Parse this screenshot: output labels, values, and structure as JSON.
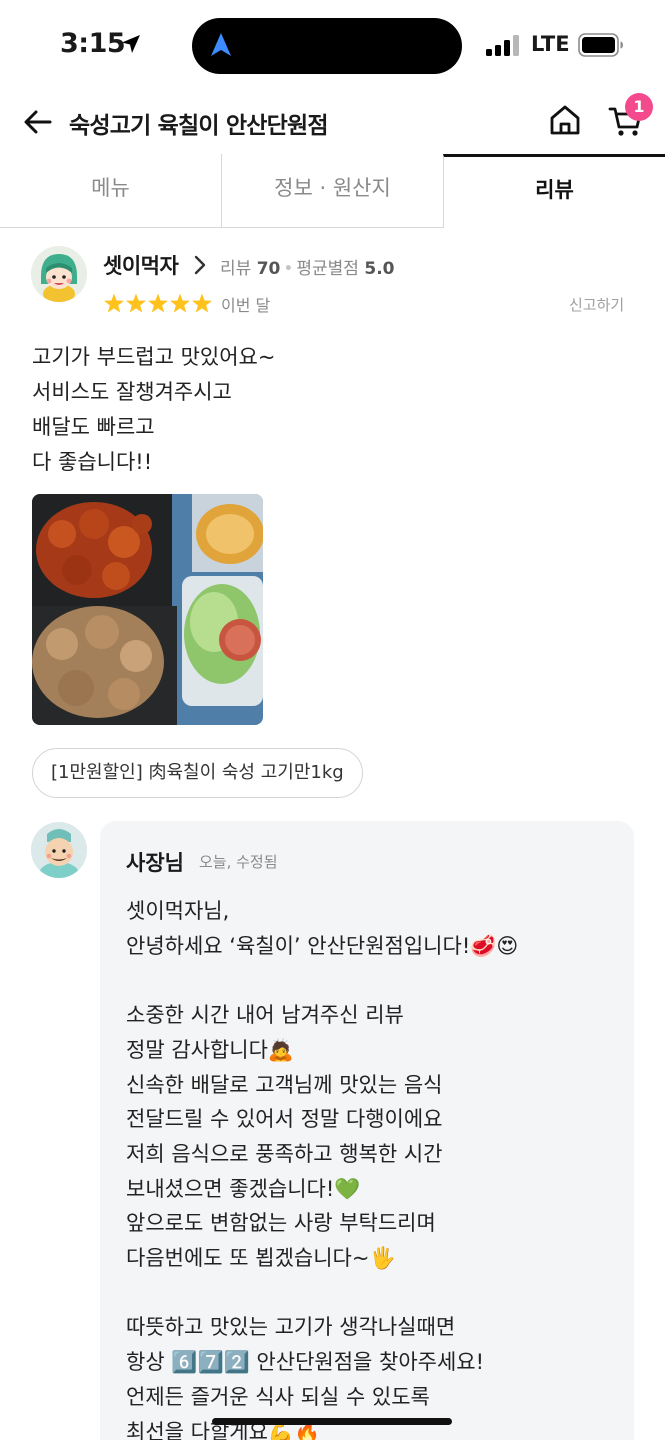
{
  "status_bar": {
    "time": "3:15",
    "network": "LTE"
  },
  "header": {
    "title": "숙성고기 육칠이 안산단원점",
    "cart_count": "1"
  },
  "tabs": [
    {
      "label": "메뉴"
    },
    {
      "label": "정보 · 원산지"
    },
    {
      "label": "리뷰"
    }
  ],
  "review": {
    "nickname": "셋이먹자",
    "review_count_label": "리뷰",
    "review_count": "70",
    "avg_label": "평균별점",
    "avg_rating": "5.0",
    "stars": 5,
    "date": "이번 달",
    "report_label": "신고하기",
    "text_lines": [
      "고기가 부드럽고 맛있어요~",
      "서비스도 잘챙겨주시고",
      "배달도 빠르고",
      "다 좋습니다!!"
    ],
    "menu_chip": "[1만원할인] 肉육칠이 숙성 고기만1kg"
  },
  "reply": {
    "author": "사장님",
    "meta": "오늘, 수정됨",
    "text": "셋이먹자님,\n안녕하세요 ‘육칠이’ 안산단원점입니다!🥩😍\n\n소중한 시간 내어 남겨주신 리뷰\n정말 감사합니다🙇\n신속한 배달로 고객님께 맛있는 음식\n전달드릴 수 있어서 정말 다행이에요\n저희 음식으로 풍족하고 행복한 시간\n보내셨으면 좋겠습니다!💚\n앞으로도 변함없는 사랑 부탁드리며\n다음번에도 또 뵙겠습니다~🖐\n\n따뜻하고 맛있는 고기가 생각나실때면\n항상 6️⃣7️⃣2️⃣ 안산단원점을 찾아주세요!\n언제든 즐거운 식사 되실 수 있도록\n최선을 다할게요💪🔥"
  },
  "colors": {
    "accent_badge": "#f24a8c",
    "star": "#ffc21c",
    "reply_bg": "#f4f5f7"
  }
}
